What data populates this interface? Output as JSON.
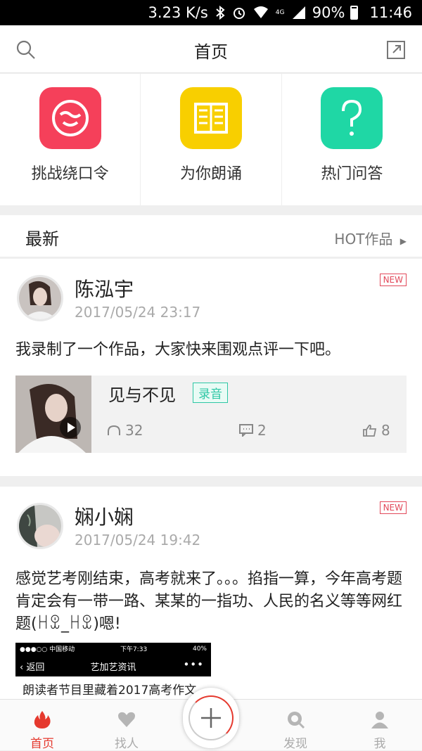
{
  "status_bar": {
    "speed": "3.23 K/s",
    "network": "4G",
    "battery": "90%",
    "time": "11:46"
  },
  "nav": {
    "title": "首页"
  },
  "quick_actions": [
    {
      "label": "挑战绕口令",
      "color": "#f5405a"
    },
    {
      "label": "为你朗诵",
      "color": "#f8cf00"
    },
    {
      "label": "热门问答",
      "color": "#1fd7a5"
    }
  ],
  "latest": {
    "title": "最新",
    "hot_link": "HOT作品"
  },
  "posts": [
    {
      "user": "陈泓宇",
      "time": "2017/05/24 23:17",
      "badge": "NEW",
      "text": "我录制了一个作品，大家快来围观点评一下吧。",
      "work": {
        "title": "见与不见",
        "tag": "录音",
        "listens": "32",
        "comments": "2",
        "likes": "8"
      }
    },
    {
      "user": "娴小娴",
      "time": "2017/05/24 19:42",
      "badge": "NEW",
      "text": "感觉艺考刚结束，高考就来了。。。掐指一算，今年高考题肯定会有一带一路、某某的一指功、人民的名义等等网红题(ꀿꀾ_ꀿꀾ)嗯!",
      "screenshot": {
        "carrier": "●●●○○ 中国移动",
        "time": "下午7:33",
        "battery": "40%",
        "back": "返回",
        "title": "艺加艺资讯",
        "more": "•••"
      },
      "caption": "朗读者节目里藏着2017高考作文"
    }
  ],
  "tabs": [
    {
      "label": "首页",
      "active": true
    },
    {
      "label": "找人"
    },
    {
      "label": "发现"
    },
    {
      "label": "我"
    }
  ]
}
